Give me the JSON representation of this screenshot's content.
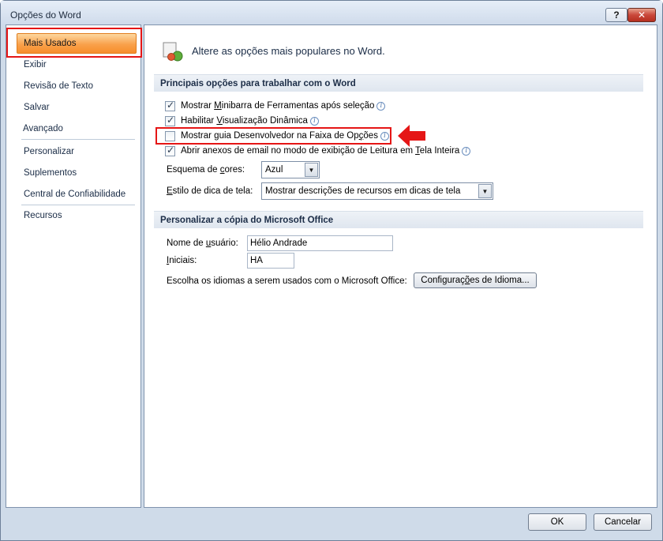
{
  "window": {
    "title": "Opções do Word",
    "help_label": "?",
    "close_label": "✕"
  },
  "sidebar": {
    "items": [
      {
        "label": "Mais Usados",
        "selected": true
      },
      {
        "label": "Exibir"
      },
      {
        "label": "Revisão de Texto"
      },
      {
        "label": "Salvar"
      },
      {
        "label": "Avançado"
      },
      {
        "label": "Personalizar"
      },
      {
        "label": "Suplementos"
      },
      {
        "label": "Central de Confiabilidade"
      },
      {
        "label": "Recursos"
      }
    ]
  },
  "main": {
    "header_text": "Altere as opções mais populares no Word.",
    "section1": {
      "title": "Principais opções para trabalhar com o Word",
      "checkboxes": [
        {
          "pre": "Mostrar ",
          "u": "M",
          "post": "inibarra de Ferramentas após seleção",
          "checked": true
        },
        {
          "pre": "Habilitar ",
          "u": "V",
          "post": "isualização Dinâmica",
          "checked": true
        },
        {
          "pre": "Mostrar guia Desenvolvedor na Faixa de Op",
          "u": "ç",
          "post": "ões",
          "checked": false
        },
        {
          "pre": "Abrir anexos de email no modo de exibição de Leitura em ",
          "u": "T",
          "post": "ela Inteira",
          "checked": true
        }
      ],
      "color_scheme": {
        "pre": "Esquema de ",
        "u": "c",
        "post": "ores:",
        "value": "Azul"
      },
      "tooltip_style": {
        "u": "E",
        "post": "stilo de dica de tela:",
        "value": "Mostrar descrições de recursos em dicas de tela"
      }
    },
    "section2": {
      "title": "Personalizar a cópia do Microsoft Office",
      "username": {
        "pre": "Nome de ",
        "u": "u",
        "post": "suário:",
        "value": "Hélio Andrade"
      },
      "initials": {
        "u": "I",
        "post": "niciais:",
        "value": "HA"
      },
      "languages": {
        "label": "Escolha os idiomas a serem usados com o Microsoft Office:",
        "button_pre": "Configuraç",
        "button_u": "õ",
        "button_post": "es de Idioma..."
      }
    }
  },
  "footer": {
    "ok_label": "OK",
    "cancel_label": "Cancelar"
  },
  "colors": {
    "highlight_red": "#e51616",
    "selected_orange": "#f9a14b"
  }
}
